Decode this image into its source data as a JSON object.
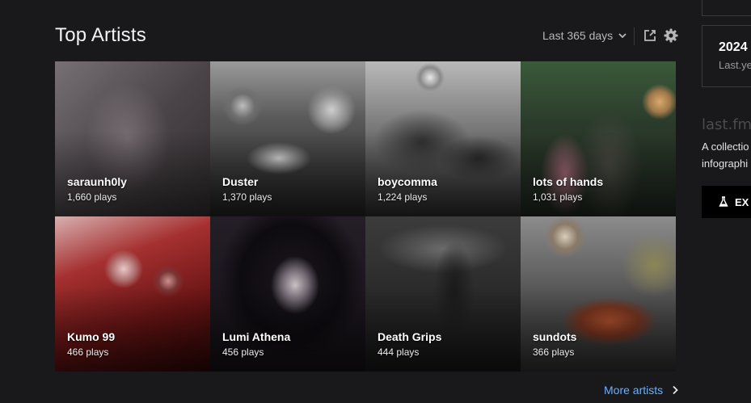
{
  "section": {
    "title": "Top Artists",
    "period_label": "Last 365 days",
    "more_label": "More artists"
  },
  "icons": {
    "period": "chevron-down-icon",
    "share": "share-icon",
    "settings": "gear-icon",
    "more": "chevron-right-icon",
    "explore": "flask-icon"
  },
  "artists": [
    {
      "name": "saraunh0ly",
      "plays": "1,660 plays"
    },
    {
      "name": "Duster",
      "plays": "1,370 plays"
    },
    {
      "name": "boycomma",
      "plays": "1,224 plays"
    },
    {
      "name": "lots of hands",
      "plays": "1,031 plays"
    },
    {
      "name": "Kumo 99",
      "plays": "466 plays"
    },
    {
      "name": "Lumi Athena",
      "plays": "456 plays"
    },
    {
      "name": "Death Grips",
      "plays": "444 plays"
    },
    {
      "name": "sundots",
      "plays": "366 plays"
    }
  ],
  "right_panel": {
    "card_year": "2024",
    "card_sub": "Last.ye",
    "logo_text": "last.fm",
    "desc_line1": "A collectio",
    "desc_line2": "infographi",
    "button_label": "EX"
  },
  "colors": {
    "background": "#19191b",
    "link": "#6ab0ff",
    "muted_text": "#b7b7b7"
  }
}
